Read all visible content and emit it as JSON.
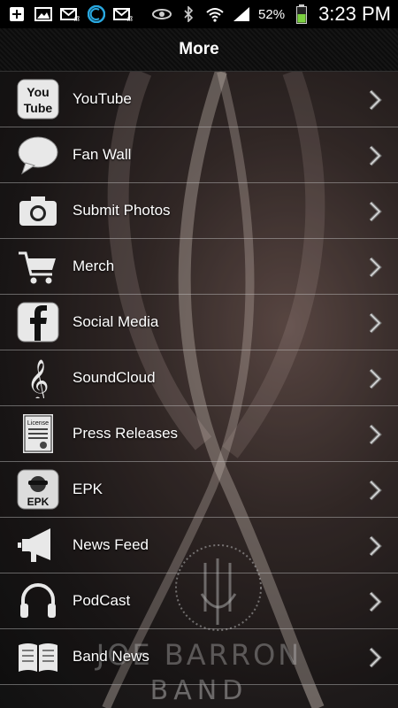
{
  "status_bar": {
    "battery": "52%",
    "time": "3:23 PM",
    "icons_left": [
      "add-icon",
      "image-icon",
      "email-icon",
      "app-icon",
      "email-icon"
    ],
    "icons_right": [
      "eye-icon",
      "bluetooth-icon",
      "wifi-icon",
      "signal-icon",
      "battery-icon"
    ]
  },
  "header": {
    "title": "More"
  },
  "menu": {
    "items": [
      {
        "label": "YouTube",
        "icon": "youtube-icon",
        "icon_text_1": "You",
        "icon_text_2": "Tube"
      },
      {
        "label": "Fan Wall",
        "icon": "speech-bubble-icon"
      },
      {
        "label": "Submit Photos",
        "icon": "camera-icon"
      },
      {
        "label": "Merch",
        "icon": "shopping-cart-icon"
      },
      {
        "label": "Social Media",
        "icon": "facebook-icon"
      },
      {
        "label": "SoundCloud",
        "icon": "treble-clef-icon"
      },
      {
        "label": "Press Releases",
        "icon": "license-icon",
        "icon_text": "License"
      },
      {
        "label": "EPK",
        "icon": "epk-icon",
        "icon_text": "EPK"
      },
      {
        "label": "News Feed",
        "icon": "megaphone-icon"
      },
      {
        "label": "PodCast",
        "icon": "headphones-icon"
      },
      {
        "label": "Band News",
        "icon": "book-icon"
      }
    ]
  },
  "background": {
    "logo_line1": "JOE BARRON",
    "logo_line2": "BAND"
  },
  "colors": {
    "row_divider": "#a8a8a8",
    "accent_battery": "#7bd13f",
    "accent_app": "#29a8e0"
  }
}
